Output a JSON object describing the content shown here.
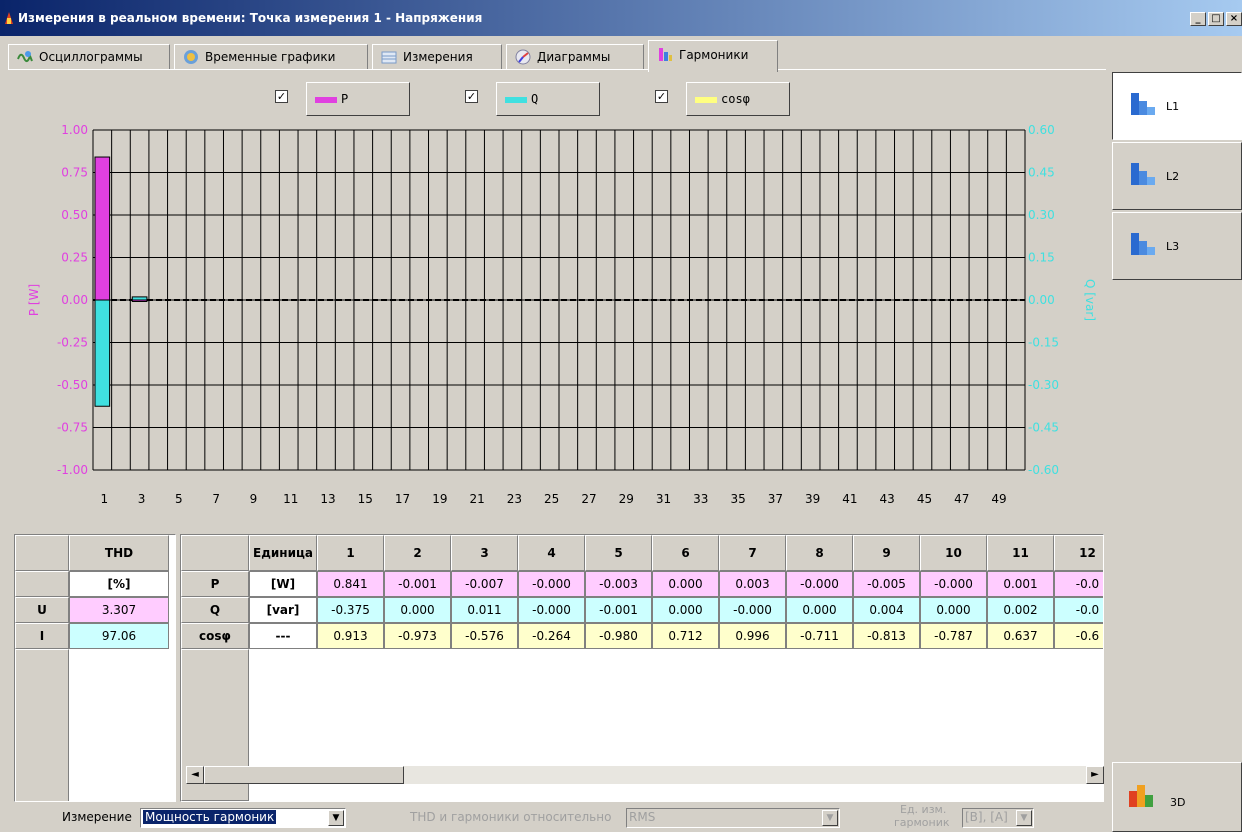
{
  "window": {
    "title": "Измерения в реальном времени: Точка измерения 1 - Напряжения",
    "minimize": "_",
    "maximize": "□",
    "close": "×"
  },
  "tabs": [
    {
      "label": "Осциллограммы",
      "icon": "waveform-icon"
    },
    {
      "label": "Временные графики",
      "icon": "globe-chart-icon"
    },
    {
      "label": "Измерения",
      "icon": "table-icon"
    },
    {
      "label": "Диаграммы",
      "icon": "phasor-icon"
    },
    {
      "label": "Гармоники",
      "icon": "harmonics-icon",
      "active": true
    }
  ],
  "legend": [
    {
      "label": "P",
      "checked": true,
      "check_mark": "✓",
      "color": "#e040e0"
    },
    {
      "label": "Q",
      "checked": true,
      "check_mark": "✓",
      "color": "#40e0e0"
    },
    {
      "label": "cosφ",
      "checked": true,
      "check_mark": "✓",
      "color": "#ffff80"
    }
  ],
  "chart_data": {
    "type": "bar",
    "ylabel_left": "P [W]",
    "ylabel_right": "Q [var]",
    "ylim_left": [
      -1.0,
      1.0
    ],
    "ylim_right": [
      -0.6,
      0.6
    ],
    "yticks_left": [
      "1.00",
      "0.75",
      "0.50",
      "0.25",
      "0.00",
      "-0.25",
      "-0.50",
      "-0.75",
      "-1.00"
    ],
    "yticks_right": [
      "0.60",
      "0.45",
      "0.30",
      "0.15",
      "0.00",
      "-0.15",
      "-0.30",
      "-0.45",
      "-0.60"
    ],
    "xticks": [
      "1",
      "3",
      "5",
      "7",
      "9",
      "11",
      "13",
      "15",
      "17",
      "19",
      "21",
      "23",
      "25",
      "27",
      "29",
      "31",
      "33",
      "35",
      "37",
      "39",
      "41",
      "43",
      "45",
      "47",
      "49"
    ],
    "harmonic_count": 50,
    "grid": true,
    "series": [
      {
        "name": "P",
        "color": "#e040e0",
        "axis": "left",
        "values": {
          "1": 0.841,
          "3": -0.007
        }
      },
      {
        "name": "Q",
        "color": "#40e0e0",
        "axis": "right",
        "values": {
          "1": -0.375,
          "3": 0.011
        }
      }
    ]
  },
  "phases": [
    {
      "label": "L1",
      "active": true
    },
    {
      "label": "L2",
      "active": false
    },
    {
      "label": "L3",
      "active": false
    }
  ],
  "thd_table": {
    "header": "THD",
    "unit": "[%]",
    "rows": [
      {
        "label": "U",
        "value": "3.307",
        "color": "#ffccff"
      },
      {
        "label": "I",
        "value": "97.06",
        "color": "#ccffff"
      }
    ]
  },
  "harm_table": {
    "unit_header": "Единица",
    "columns": [
      "1",
      "2",
      "3",
      "4",
      "5",
      "6",
      "7",
      "8",
      "9",
      "10",
      "11",
      "12"
    ],
    "rows": [
      {
        "label": "P",
        "unit": "[W]",
        "color": "#ffccff",
        "values": [
          "0.841",
          "-0.001",
          "-0.007",
          "-0.000",
          "-0.003",
          "0.000",
          "0.003",
          "-0.000",
          "-0.005",
          "-0.000",
          "0.001",
          "-0.0"
        ]
      },
      {
        "label": "Q",
        "unit": "[var]",
        "color": "#ccffff",
        "values": [
          "-0.375",
          "0.000",
          "0.011",
          "-0.000",
          "-0.001",
          "0.000",
          "-0.000",
          "0.000",
          "0.004",
          "0.000",
          "0.002",
          "-0.0"
        ]
      },
      {
        "label": "cosφ",
        "unit": "---",
        "color": "#ffffcc",
        "values": [
          "0.913",
          "-0.973",
          "-0.576",
          "-0.264",
          "-0.980",
          "0.712",
          "0.996",
          "-0.711",
          "-0.813",
          "-0.787",
          "0.637",
          "-0.6"
        ]
      }
    ]
  },
  "scroll": {
    "left": "◄",
    "right": "►"
  },
  "bottom": {
    "measure_label": "Измерение",
    "measure_value": "Мощность гармоник",
    "thd_label": "THD и гармоники относительно",
    "thd_value": "RMS",
    "unit_label_1": "Ед. изм.",
    "unit_label_2": "гармоник",
    "unit_value": "[В], [А]",
    "dropdown_arrow": "▼"
  },
  "btn3d": {
    "label": "3D"
  }
}
